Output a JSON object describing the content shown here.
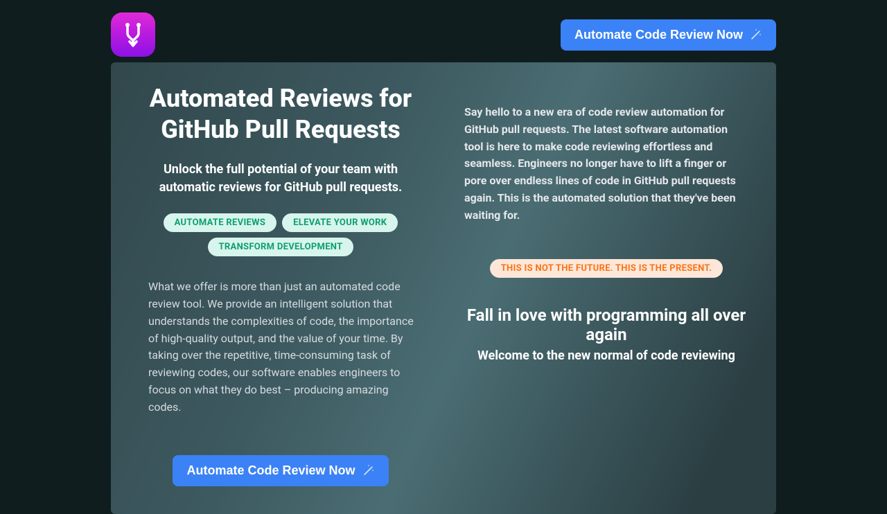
{
  "header": {
    "cta_label": "Automate Code Review Now"
  },
  "hero": {
    "title": "Automated Reviews for GitHub Pull Requests",
    "subhead": "Unlock the full potential of your team with automatic reviews for GitHub pull requests.",
    "pills": [
      "AUTOMATE REVIEWS",
      "ELEVATE YOUR WORK",
      "TRANSFORM DEVELOPMENT"
    ],
    "body": "What we offer is more than just an automated code review tool. We provide an intelligent solution that understands the complexities of code, the importance of high-quality output, and the value of your time. By taking over the repetitive, time-consuming task of reviewing codes, our software enables engineers to focus on what they do best – producing amazing codes.",
    "cta_label": "Automate Code Review Now"
  },
  "right": {
    "intro": "Say hello to a new era of code review automation for GitHub pull requests. The latest software automation tool is here to make code reviewing effortless and seamless. Engineers no longer have to lift a finger or pore over endless lines of code in GitHub pull requests again. This is the automated solution that they've been waiting for.",
    "pill": "THIS IS NOT THE FUTURE. THIS IS THE PRESENT.",
    "tagline1": "Fall in love with programming all over again",
    "tagline2": "Welcome to the new normal of code reviewing"
  }
}
